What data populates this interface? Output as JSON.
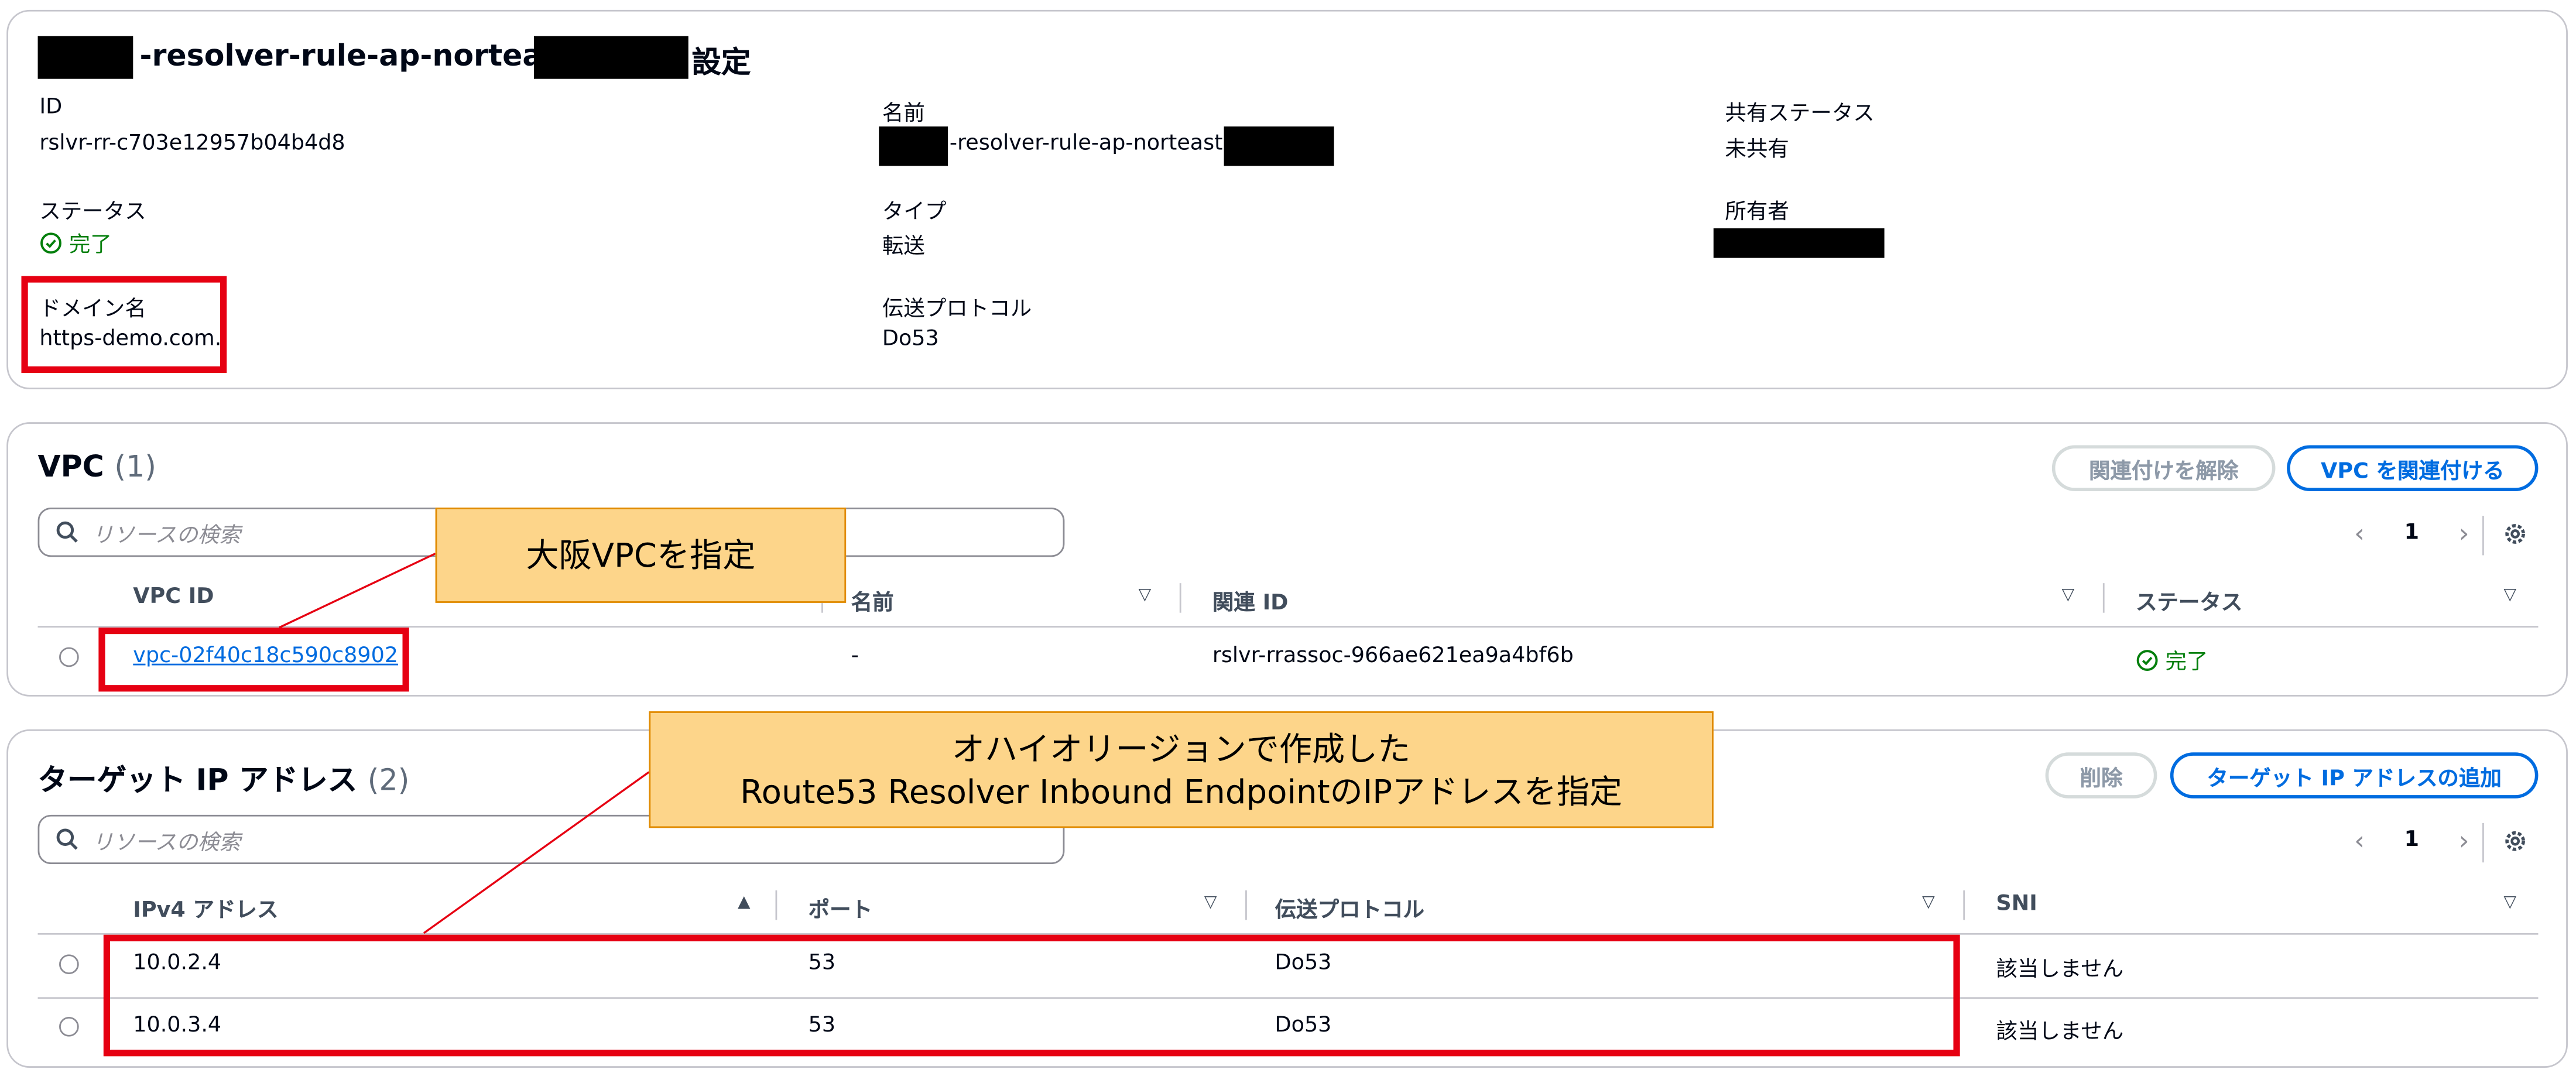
{
  "settings": {
    "title_suffix": "-resolver-rule-ap-norteast3-",
    "title_end": "設定",
    "id_label": "ID",
    "id_value": "rslvr-rr-c703e12957b04b4d8",
    "name_label": "名前",
    "name_value": "-resolver-rule-ap-norteast3-",
    "sharing_label": "共有ステータス",
    "sharing_value": "未共有",
    "status_label": "ステータス",
    "status_value": "完了",
    "type_label": "タイプ",
    "type_value": "転送",
    "owner_label": "所有者",
    "domain_label": "ドメイン名",
    "domain_value": "https-demo.com.",
    "protocol_label": "伝送プロトコル",
    "protocol_value": "Do53"
  },
  "vpc": {
    "title": "VPC",
    "count": "(1)",
    "btn_disassociate": "関連付けを解除",
    "btn_associate": "VPC を関連付ける",
    "search_placeholder": "リソースの検索",
    "page": "1",
    "columns": [
      "VPC ID",
      "名前",
      "関連 ID",
      "ステータス"
    ],
    "rows": [
      {
        "vpc_id": "vpc-02f40c18c590c8902",
        "name": "-",
        "assoc_id": "rslvr-rrassoc-966ae621ea9a4bf6b",
        "status": "完了"
      }
    ]
  },
  "target": {
    "title": "ターゲット IP アドレス",
    "count": "(2)",
    "btn_delete": "削除",
    "btn_add": "ターゲット IP アドレスの追加",
    "search_placeholder": "リソースの検索",
    "page": "1",
    "columns": [
      "IPv4 アドレス",
      "ポート",
      "伝送プロトコル",
      "SNI"
    ],
    "rows": [
      {
        "ip": "10.0.2.4",
        "port": "53",
        "protocol": "Do53",
        "sni": "該当しません"
      },
      {
        "ip": "10.0.3.4",
        "port": "53",
        "protocol": "Do53",
        "sni": "該当しません"
      }
    ]
  },
  "annotations": {
    "callout1": "大阪VPCを指定",
    "callout2_line1": "オハイオリージョンで作成した",
    "callout2_line2": "Route53 Resolver Inbound EndpointのIPアドレスを指定"
  },
  "colors": {
    "success": "#037f0c",
    "link": "#006ce0",
    "highlight_red": "#e60012",
    "callout_fill": "#fdd58a"
  }
}
